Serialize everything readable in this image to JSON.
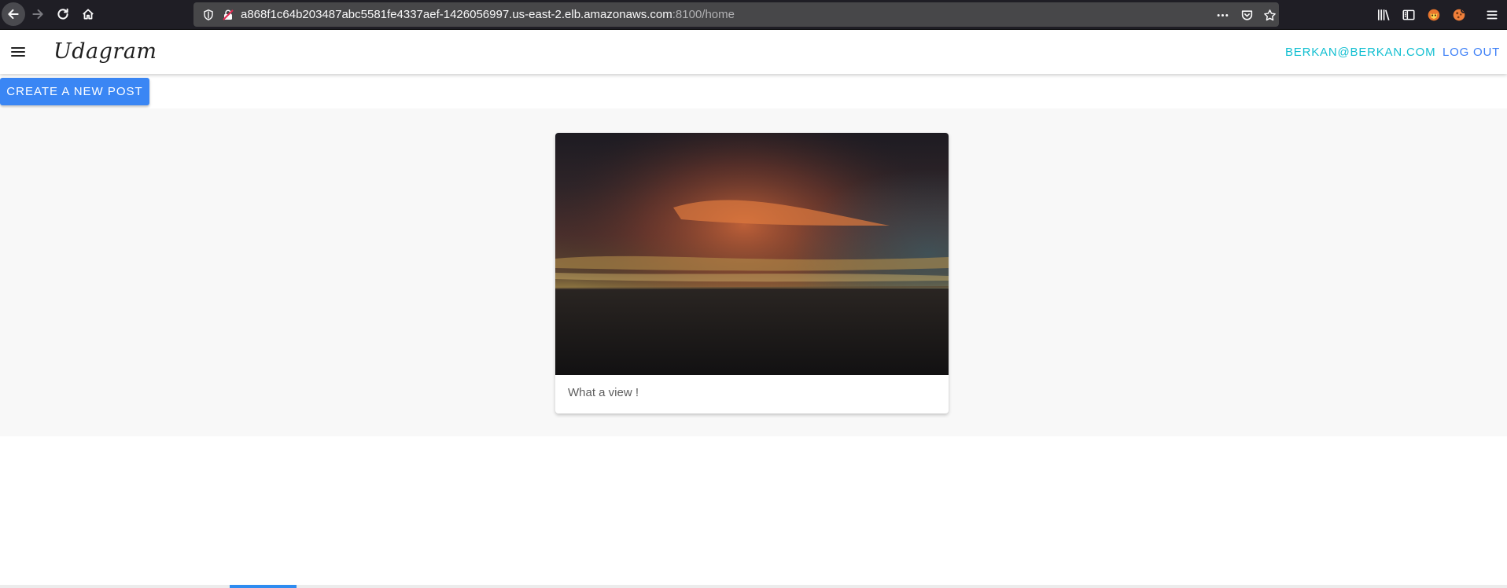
{
  "browser": {
    "url_host": "a868f1c64b203487abc5581fe4337aef-1426056997.us-east-2.elb.amazonaws.com",
    "url_rest": ":8100/home",
    "icons": {
      "back": "back-arrow-icon",
      "forward": "forward-arrow-icon",
      "reload": "reload-icon",
      "home": "home-icon",
      "tracking": "shield-icon",
      "insecure": "insecure-lock-icon",
      "page_actions": "more-dots-icon",
      "pocket": "pocket-icon",
      "bookmark": "star-icon",
      "library": "library-icon",
      "sidebar": "sidebar-icon",
      "menu": "menu-icon"
    }
  },
  "header": {
    "title": "Udagram",
    "user_email": "BERKAN@BERKAN.COM",
    "logout_label": "LOG OUT",
    "menu_icon": "hamburger-icon"
  },
  "toolbar": {
    "create_post_label": "CREATE A NEW POST"
  },
  "feed": {
    "posts": [
      {
        "caption": "What a view !",
        "image": "sunset-over-sea-photo"
      }
    ]
  },
  "colors": {
    "primary": "#3a86f4",
    "accent": "#12bfd1",
    "feed_background": "#f8f8f8"
  }
}
